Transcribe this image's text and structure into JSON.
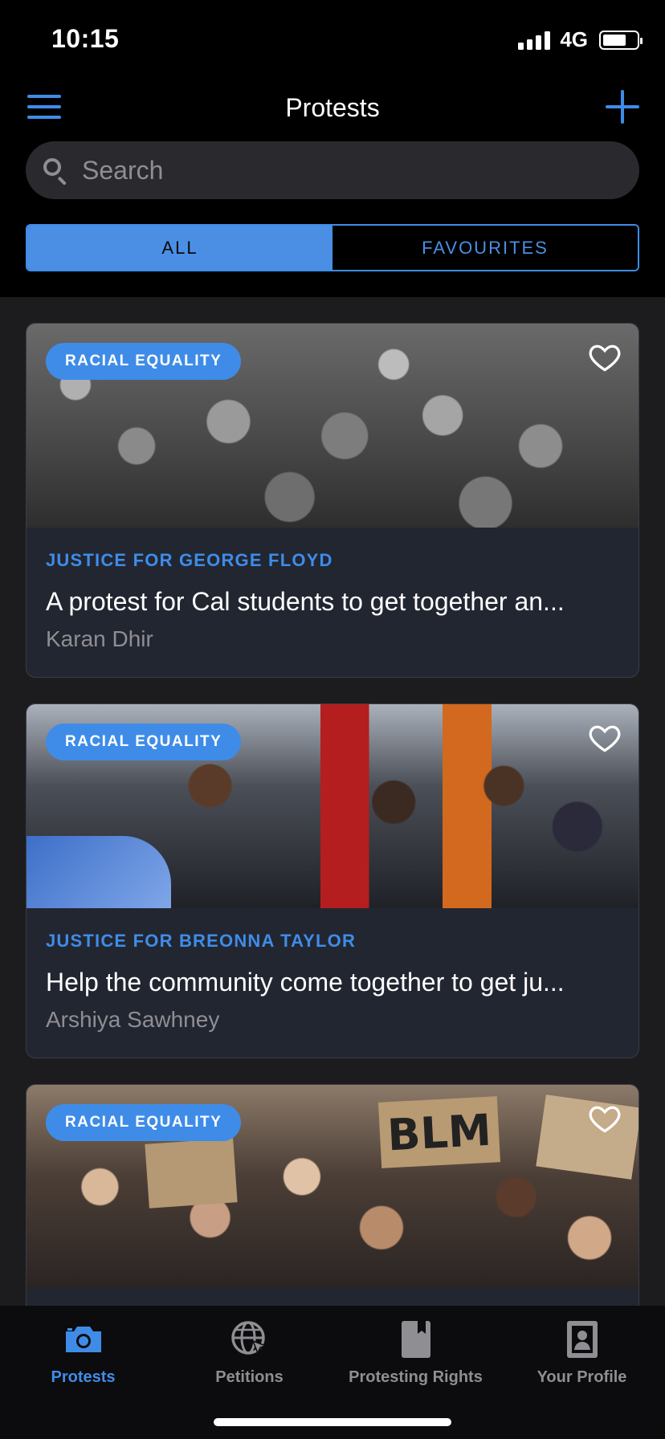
{
  "status_bar": {
    "time": "10:15",
    "network": "4G"
  },
  "nav": {
    "title": "Protests"
  },
  "search": {
    "placeholder": "Search"
  },
  "segments": {
    "all": "ALL",
    "favourites": "FAVOURITES"
  },
  "cards": [
    {
      "tag": "RACIAL EQUALITY",
      "kicker": "JUSTICE FOR GEORGE FLOYD",
      "description": "A protest for Cal students to get together an...",
      "author": "Karan Dhir"
    },
    {
      "tag": "RACIAL EQUALITY",
      "kicker": "JUSTICE FOR BREONNA TAYLOR",
      "description": "Help the community come together to get ju...",
      "author": "Arshiya Sawhney"
    },
    {
      "tag": "RACIAL EQUALITY",
      "sign_text": "BLM"
    }
  ],
  "tabs": [
    {
      "label": "Protests",
      "icon": "camera-icon"
    },
    {
      "label": "Petitions",
      "icon": "globe-cursor-icon"
    },
    {
      "label": "Protesting Rights",
      "icon": "book-icon"
    },
    {
      "label": "Your Profile",
      "icon": "profile-icon"
    }
  ],
  "colors": {
    "accent": "#3f8ce8",
    "background": "#000000",
    "card": "#222631",
    "muted": "#8e8e93"
  }
}
